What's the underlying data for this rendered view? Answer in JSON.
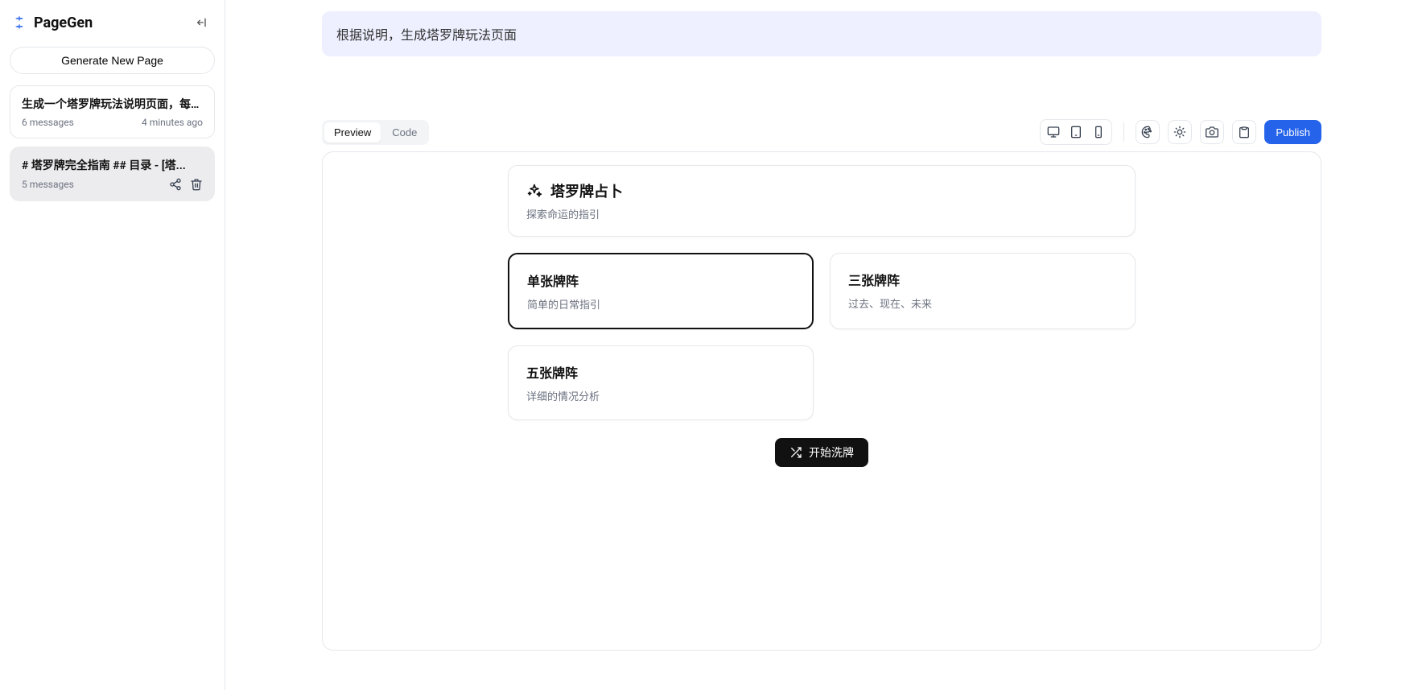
{
  "brand": {
    "name": "PageGen"
  },
  "sidebar": {
    "generate_label": "Generate New Page",
    "chats": [
      {
        "title": "生成一个塔罗牌玩法说明页面，每种玩法...",
        "messages": "6 messages",
        "time": "4 minutes ago"
      },
      {
        "title": "# 塔罗牌完全指南 ## 目录 - [塔...",
        "messages": "5 messages",
        "time": ""
      }
    ]
  },
  "prompt": {
    "text": "根据说明，生成塔罗牌玩法页面"
  },
  "tabs": {
    "preview": "Preview",
    "code": "Code",
    "active": "preview"
  },
  "toolbar": {
    "publish": "Publish"
  },
  "preview": {
    "hero": {
      "title": "塔罗牌占卜",
      "subtitle": "探索命运的指引"
    },
    "spreads": [
      {
        "title": "单张牌阵",
        "subtitle": "简单的日常指引",
        "selected": true
      },
      {
        "title": "三张牌阵",
        "subtitle": "过去、现在、未来",
        "selected": false
      },
      {
        "title": "五张牌阵",
        "subtitle": "详细的情况分析",
        "selected": false
      }
    ],
    "shuffle_label": "开始洗牌"
  }
}
